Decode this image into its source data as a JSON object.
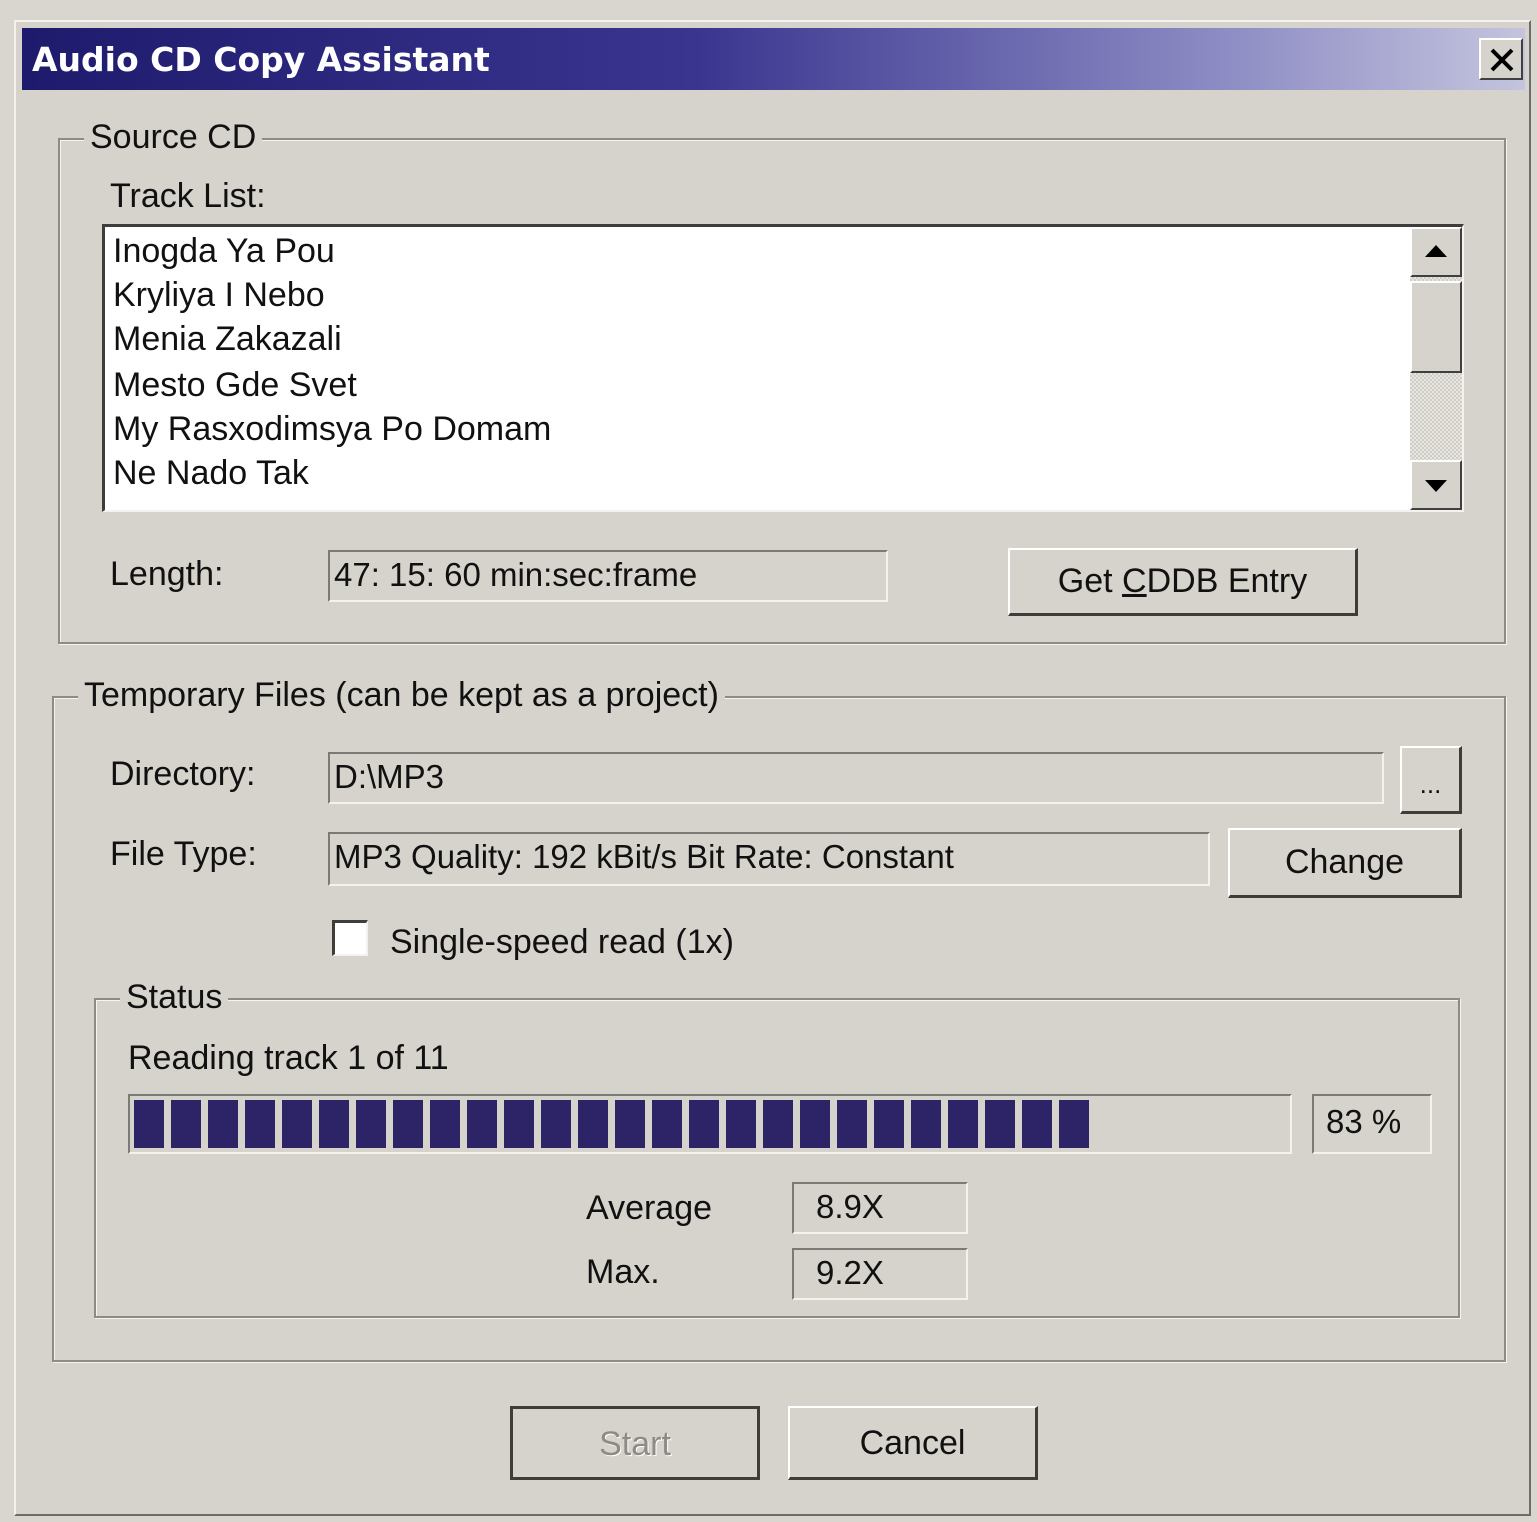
{
  "window": {
    "title": "Audio CD Copy Assistant",
    "close_label": "✕"
  },
  "source_cd": {
    "legend": "Source CD",
    "track_list_label": "Track List:",
    "tracks": [
      "Inogda Ya Pou",
      "Kryliya I Nebo",
      "Menia Zakazali",
      "Mesto Gde Svet",
      "My Rasxodimsya Po Domam",
      "Ne Nado Tak"
    ],
    "length_label": "Length:",
    "length_value": "47: 15: 60 min:sec:frame",
    "cddb_button_prefix": "Get ",
    "cddb_button_accel": "C",
    "cddb_button_suffix": "DDB Entry"
  },
  "temp_files": {
    "legend": "Temporary Files (can be kept as a project)",
    "directory_label": "Directory:",
    "directory_value": "D:\\MP3",
    "browse_label": "...",
    "file_type_label": "File Type:",
    "file_type_value": "MP3 Quality: 192 kBit/s Bit Rate: Constant",
    "change_label": "Change",
    "single_speed_label": "Single-speed read (1x)",
    "single_speed_checked": false
  },
  "status": {
    "legend": "Status",
    "message": "Reading track 1 of 11",
    "progress_fraction": 0.83,
    "progress_text": "83 %",
    "average_label": "Average",
    "average_value": "8.9X",
    "max_label": "Max.",
    "max_value": "9.2X"
  },
  "footer": {
    "start_label": "Start",
    "cancel_label": "Cancel"
  },
  "colors": {
    "title_gradient_start": "#1e1a6c",
    "title_gradient_end": "#c4c4de",
    "progress_fill": "#2c2466",
    "dialog_face": "#d6d3cc"
  }
}
